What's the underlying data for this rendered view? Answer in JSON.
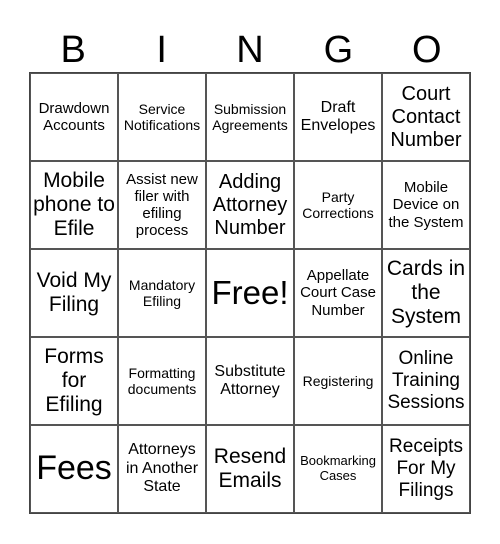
{
  "header": [
    "B",
    "I",
    "N",
    "G",
    "O"
  ],
  "cells": [
    [
      "Drawdown Accounts",
      "Service Notifications",
      "Submission Agreements",
      "Draft Envelopes",
      "Court Contact Number"
    ],
    [
      "Mobile phone to Efile",
      "Assist new filer with efiling process",
      "Adding Attorney Number",
      "Party Corrections",
      "Mobile Device on the System"
    ],
    [
      "Void My Filing",
      "Mandatory Efiling",
      "Free!",
      "Appellate Court Case Number",
      "Cards in the System"
    ],
    [
      "Forms for Efiling",
      "Formatting documents",
      "Substitute Attorney",
      "Registering",
      "Online Training Sessions"
    ],
    [
      "Fees",
      "Attorneys in Another State",
      "Resend Emails",
      "Bookmarking Cases",
      "Receipts For My Filings"
    ]
  ]
}
